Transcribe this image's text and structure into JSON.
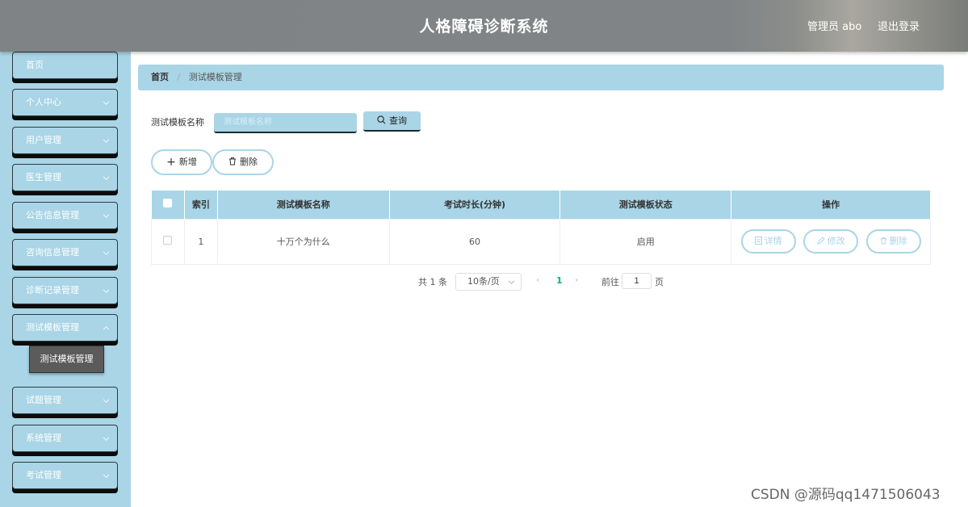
{
  "header": {
    "title": "人格障碍诊断系统",
    "user": "管理员 abo",
    "logout": "退出登录"
  },
  "sidebar": {
    "items": [
      {
        "label": "首页",
        "has_chevron": false
      },
      {
        "label": "个人中心",
        "has_chevron": true
      },
      {
        "label": "用户管理",
        "has_chevron": true
      },
      {
        "label": "医生管理",
        "has_chevron": true
      },
      {
        "label": "公告信息管理",
        "has_chevron": true
      },
      {
        "label": "咨询信息管理",
        "has_chevron": true
      },
      {
        "label": "诊断记录管理",
        "has_chevron": true
      },
      {
        "label": "测试模板管理",
        "has_chevron": true
      },
      {
        "label": "试题管理",
        "has_chevron": true
      },
      {
        "label": "系统管理",
        "has_chevron": true
      },
      {
        "label": "考试管理",
        "has_chevron": true
      }
    ],
    "submenu": {
      "label": "测试模板管理"
    }
  },
  "breadcrumb": {
    "home": "首页",
    "separator": "/",
    "current": "测试模板管理"
  },
  "search": {
    "label": "测试模板名称",
    "placeholder": "测试模板名称",
    "value": "",
    "button": "查询"
  },
  "actions": {
    "add": "新增",
    "delete": "删除"
  },
  "table": {
    "headers": [
      "索引",
      "测试模板名称",
      "考试时长(分钟)",
      "测试模板状态",
      "操作"
    ],
    "rows": [
      {
        "index": "1",
        "name": "十万个为什么",
        "duration": "60",
        "status": "启用"
      }
    ],
    "row_actions": {
      "detail": "详情",
      "edit": "修改",
      "delete": "删除"
    }
  },
  "pagination": {
    "total": "共 1 条",
    "page_size": "10条/页",
    "current_page": "1",
    "goto_prefix": "前往",
    "goto_value": "1",
    "goto_suffix": "页"
  },
  "watermark": "CSDN @源码qq1471506043",
  "colors": {
    "accent": "#a9d5e6",
    "header": "#808486",
    "active_page": "#00b386"
  }
}
